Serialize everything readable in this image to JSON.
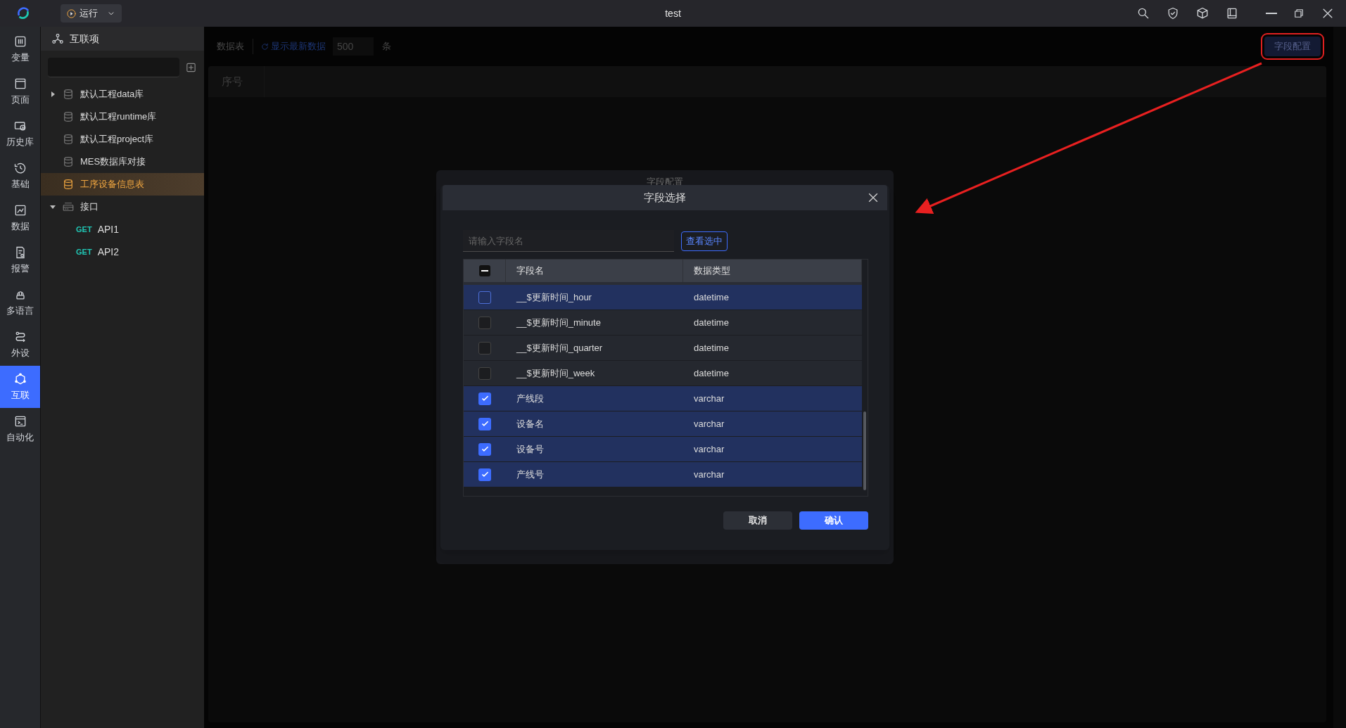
{
  "window": {
    "title": "test"
  },
  "run_button": {
    "label": "运行"
  },
  "rail": [
    {
      "label": "变量",
      "selected": false
    },
    {
      "label": "页面",
      "selected": false
    },
    {
      "label": "历史库",
      "selected": false
    },
    {
      "label": "基础",
      "selected": false
    },
    {
      "label": "数据",
      "selected": false
    },
    {
      "label": "报警",
      "selected": false
    },
    {
      "label": "多语言",
      "selected": false
    },
    {
      "label": "外设",
      "selected": false
    },
    {
      "label": "互联",
      "selected": true
    },
    {
      "label": "自动化",
      "selected": false
    }
  ],
  "tree": {
    "title": "互联项",
    "items": [
      {
        "kind": "database",
        "label": "默认工程data库",
        "expanded": false,
        "selected": false
      },
      {
        "kind": "database",
        "label": "默认工程runtime库",
        "selected": false
      },
      {
        "kind": "database",
        "label": "默认工程project库",
        "selected": false
      },
      {
        "kind": "database",
        "label": "MES数据库对接",
        "selected": false
      },
      {
        "kind": "database",
        "label": "工序设备信息表",
        "selected": true
      },
      {
        "kind": "interface",
        "label": "接口",
        "expanded": true,
        "selected": false,
        "children": [
          {
            "kind": "api",
            "method": "GET",
            "label": "API1",
            "selected": false
          },
          {
            "kind": "api",
            "method": "GET",
            "label": "API2",
            "selected": false
          }
        ]
      }
    ]
  },
  "toolbar": {
    "tab": "数据表",
    "refresh": "显示最新数据",
    "count": "500",
    "unit": "条",
    "config_button": "字段配置"
  },
  "data_table": {
    "columns": [
      "序号"
    ]
  },
  "back_dialog": {
    "title": "字段配置"
  },
  "dialog": {
    "title": "字段选择",
    "search": {
      "placeholder": "请输入字段名"
    },
    "view_selected": "查看选中",
    "columns": [
      "字段名",
      "数据类型"
    ],
    "header_indeterminate": true,
    "rows": [
      {
        "name": "__$更新时间_hour",
        "type": "datetime",
        "checked": false,
        "highlighted": true
      },
      {
        "name": "__$更新时间_minute",
        "type": "datetime",
        "checked": false,
        "highlighted": false
      },
      {
        "name": "__$更新时间_quarter",
        "type": "datetime",
        "checked": false,
        "highlighted": false
      },
      {
        "name": "__$更新时间_week",
        "type": "datetime",
        "checked": false,
        "highlighted": false
      },
      {
        "name": "产线段",
        "type": "varchar",
        "checked": true,
        "highlighted": true
      },
      {
        "name": "设备名",
        "type": "varchar",
        "checked": true,
        "highlighted": true
      },
      {
        "name": "设备号",
        "type": "varchar",
        "checked": true,
        "highlighted": true
      },
      {
        "name": "产线号",
        "type": "varchar",
        "checked": true,
        "highlighted": true
      }
    ],
    "cancel": "取消",
    "confirm": "确认"
  }
}
